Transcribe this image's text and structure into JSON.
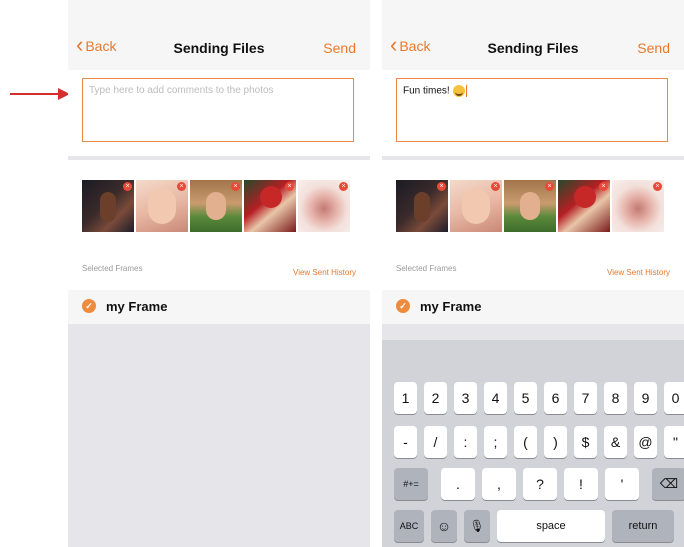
{
  "screens": [
    {
      "nav": {
        "back": "Back",
        "title": "Sending Files",
        "send": "Send"
      },
      "comment": {
        "placeholder": "Type here to add comments to the photos",
        "value": ""
      },
      "photos": [
        {
          "icon": "remove-badge"
        },
        {
          "icon": "remove-badge"
        },
        {
          "icon": "remove-badge"
        },
        {
          "icon": "remove-badge"
        },
        {
          "icon": "remove-badge"
        }
      ],
      "frames": {
        "label": "Selected Frames",
        "history": "View Sent History",
        "item": "my Frame"
      }
    },
    {
      "nav": {
        "back": "Back",
        "title": "Sending Files",
        "send": "Send"
      },
      "comment": {
        "placeholder": "",
        "value": "Fun times!"
      },
      "photos": [
        {
          "icon": "remove-badge"
        },
        {
          "icon": "remove-badge"
        },
        {
          "icon": "remove-badge"
        },
        {
          "icon": "remove-badge"
        },
        {
          "icon": "remove-badge"
        }
      ],
      "frames": {
        "label": "Selected Frames",
        "history": "View Sent History",
        "item": "my Frame"
      },
      "keyboard": {
        "row1": [
          "1",
          "2",
          "3",
          "4",
          "5",
          "6",
          "7",
          "8",
          "9",
          "0"
        ],
        "row2": [
          "-",
          "/",
          ":",
          ";",
          "(",
          ")",
          "$",
          "&",
          "@",
          "\""
        ],
        "row3": [
          "#+=",
          ".",
          ",",
          "?",
          "!",
          "'",
          "⌫"
        ],
        "row4": [
          "ABC",
          "☺",
          "🎙",
          "space",
          "return"
        ]
      }
    }
  ],
  "colors": {
    "accent": "#e8792d",
    "badge": "#e84a3a"
  }
}
